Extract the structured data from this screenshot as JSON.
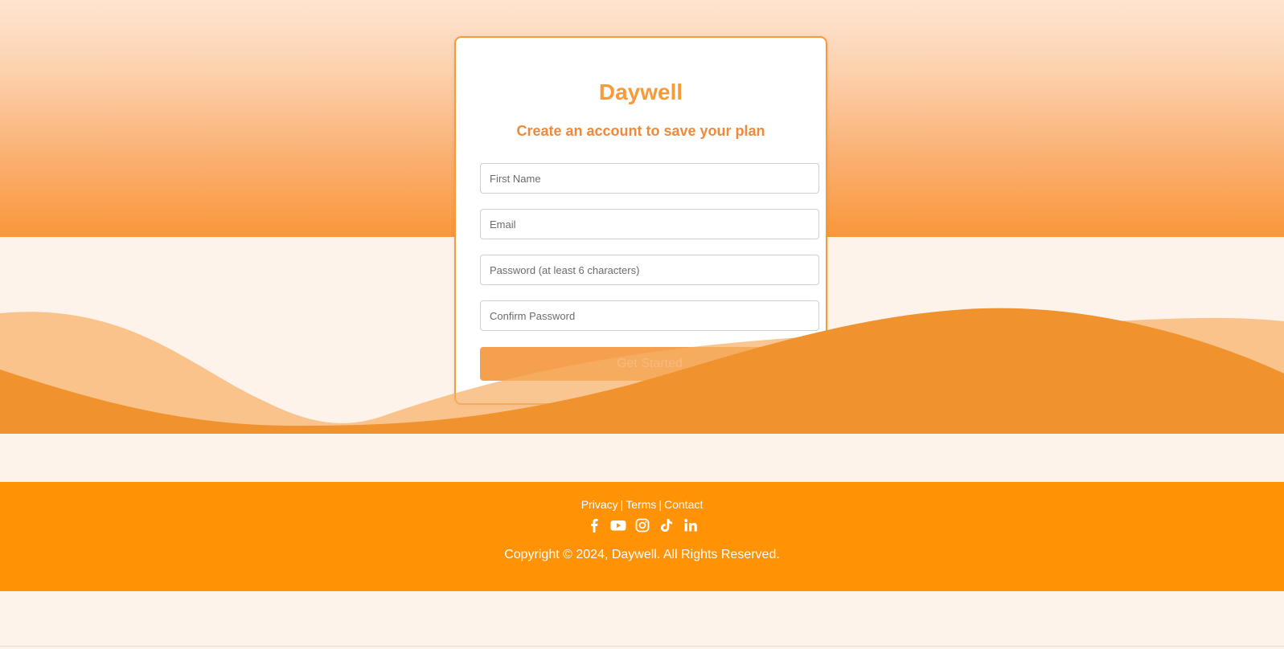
{
  "brand": "Daywell",
  "subtitle": "Create an account to save your plan",
  "form": {
    "first_name_placeholder": "First Name",
    "email_placeholder": "Email",
    "password_placeholder": "Password (at least 6 characters)",
    "confirm_placeholder": "Confirm Password",
    "submit_label": "Get Started"
  },
  "footer": {
    "links": [
      "Privacy",
      "Terms",
      "Contact"
    ],
    "separator": "|",
    "socials": [
      "facebook-icon",
      "youtube-icon",
      "instagram-icon",
      "tiktok-icon",
      "linkedin-icon"
    ],
    "copyright": "Copyright © 2024, Daywell. All Rights Reserved."
  },
  "colors": {
    "accent": "#f79a3a",
    "footer_bg": "#ff9205",
    "page_bg": "#fef3ea"
  }
}
